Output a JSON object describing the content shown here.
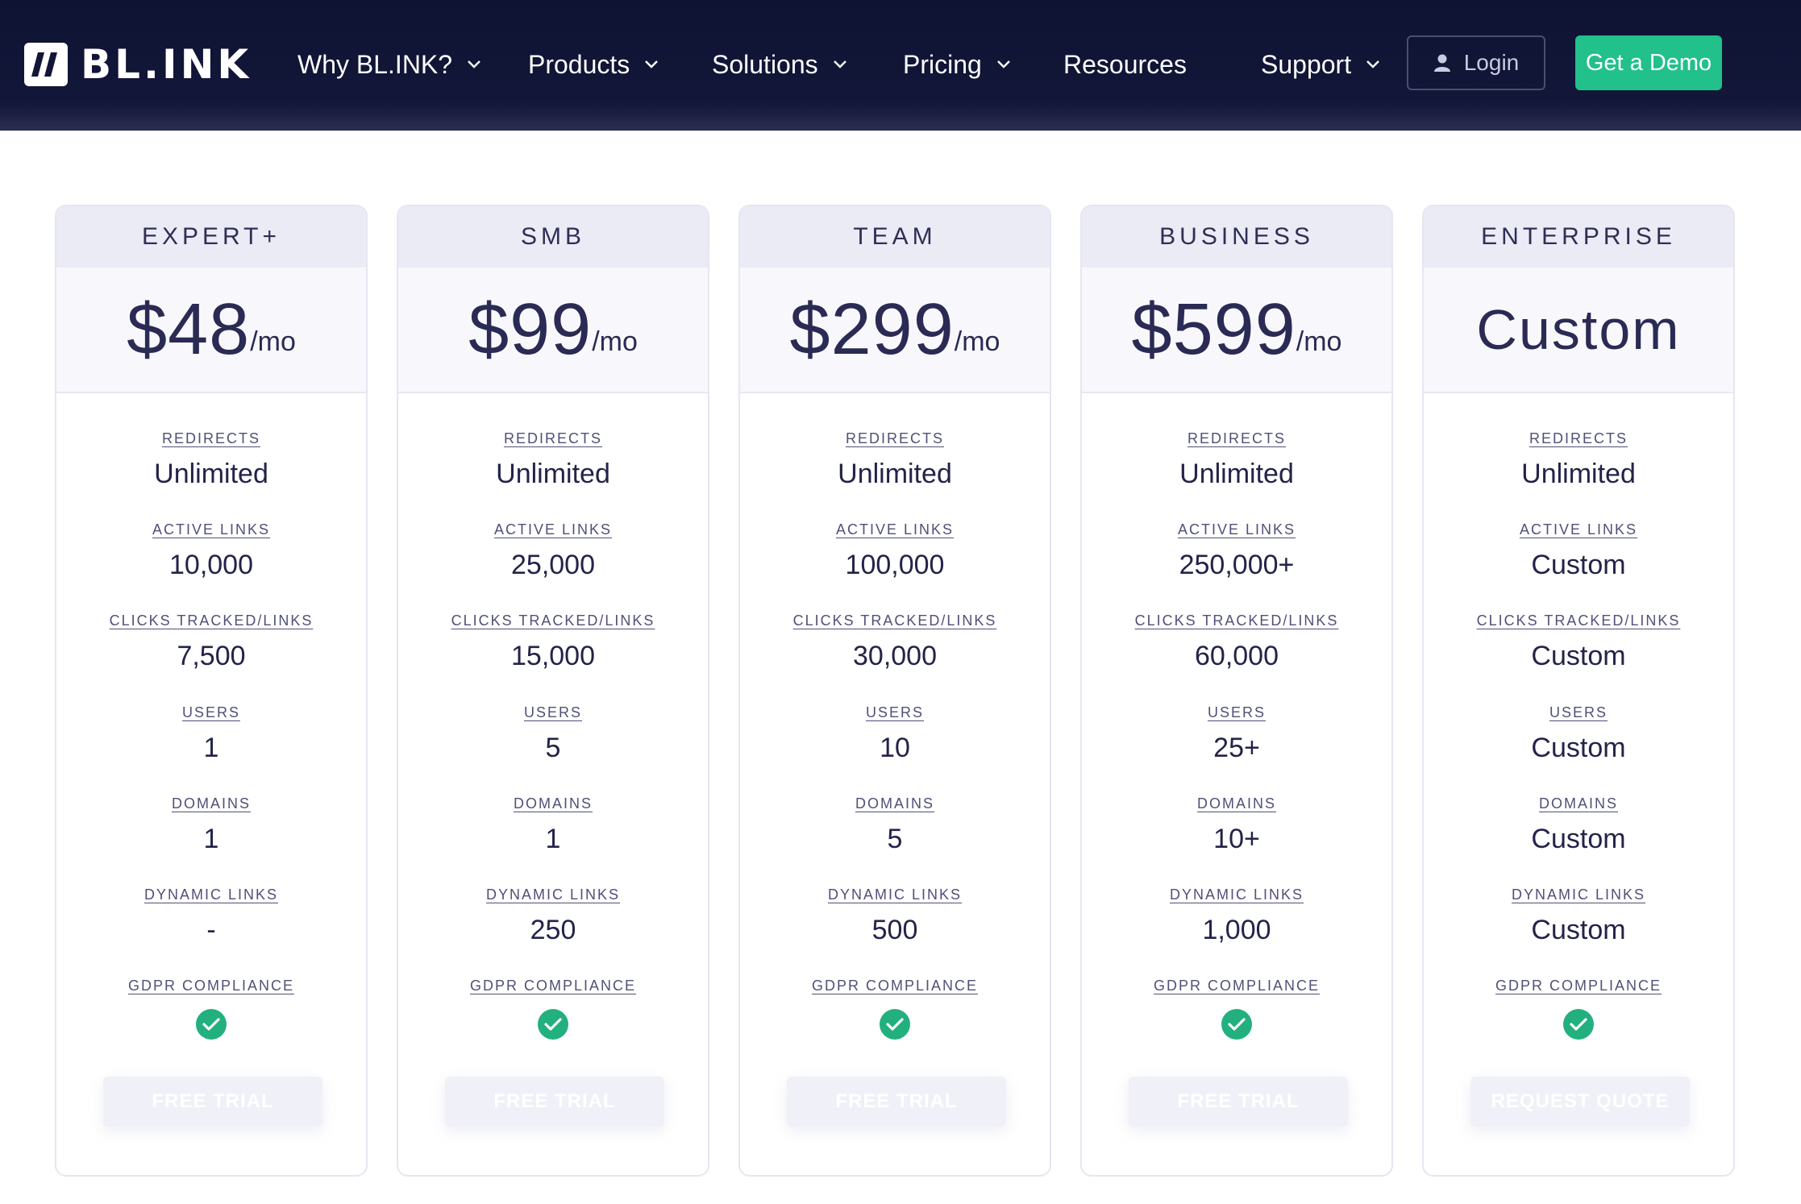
{
  "nav": {
    "logo_text": "BL.INK",
    "items": [
      {
        "label": "Why BL.INK?",
        "has_dropdown": true
      },
      {
        "label": "Products",
        "has_dropdown": true
      },
      {
        "label": "Solutions",
        "has_dropdown": true
      },
      {
        "label": "Pricing",
        "has_dropdown": true
      },
      {
        "label": "Resources",
        "has_dropdown": false
      },
      {
        "label": "Support",
        "has_dropdown": true
      }
    ],
    "login_label": "Login",
    "demo_label": "Get a Demo"
  },
  "colors": {
    "nav_bg": "#121638",
    "accent_green": "#22c08a",
    "check_green": "#22b07f",
    "text_dark": "#2a2a55",
    "card_header": "#ebebf6"
  },
  "feature_labels": [
    "REDIRECTS",
    "ACTIVE LINKS",
    "CLICKS TRACKED/LINKS",
    "USERS",
    "DOMAINS",
    "DYNAMIC LINKS",
    "GDPR COMPLIANCE"
  ],
  "plans": [
    {
      "name": "EXPERT+",
      "price": "$48",
      "unit": "/mo",
      "values": [
        "Unlimited",
        "10,000",
        "7,500",
        "1",
        "1",
        "-"
      ],
      "gdpr": true,
      "cta": "FREE TRIAL"
    },
    {
      "name": "SMB",
      "price": "$99",
      "unit": "/mo",
      "values": [
        "Unlimited",
        "25,000",
        "15,000",
        "5",
        "1",
        "250"
      ],
      "gdpr": true,
      "cta": "FREE TRIAL"
    },
    {
      "name": "TEAM",
      "price": "$299",
      "unit": "/mo",
      "values": [
        "Unlimited",
        "100,000",
        "30,000",
        "10",
        "5",
        "500"
      ],
      "gdpr": true,
      "cta": "FREE TRIAL"
    },
    {
      "name": "BUSINESS",
      "price": "$599",
      "unit": "/mo",
      "values": [
        "Unlimited",
        "250,000+",
        "60,000",
        "25+",
        "10+",
        "1,000"
      ],
      "gdpr": true,
      "cta": "FREE TRIAL"
    },
    {
      "name": "ENTERPRISE",
      "price": "Custom",
      "unit": "",
      "values": [
        "Unlimited",
        "Custom",
        "Custom",
        "Custom",
        "Custom",
        "Custom"
      ],
      "gdpr": true,
      "cta": "REQUEST QUOTE"
    }
  ]
}
